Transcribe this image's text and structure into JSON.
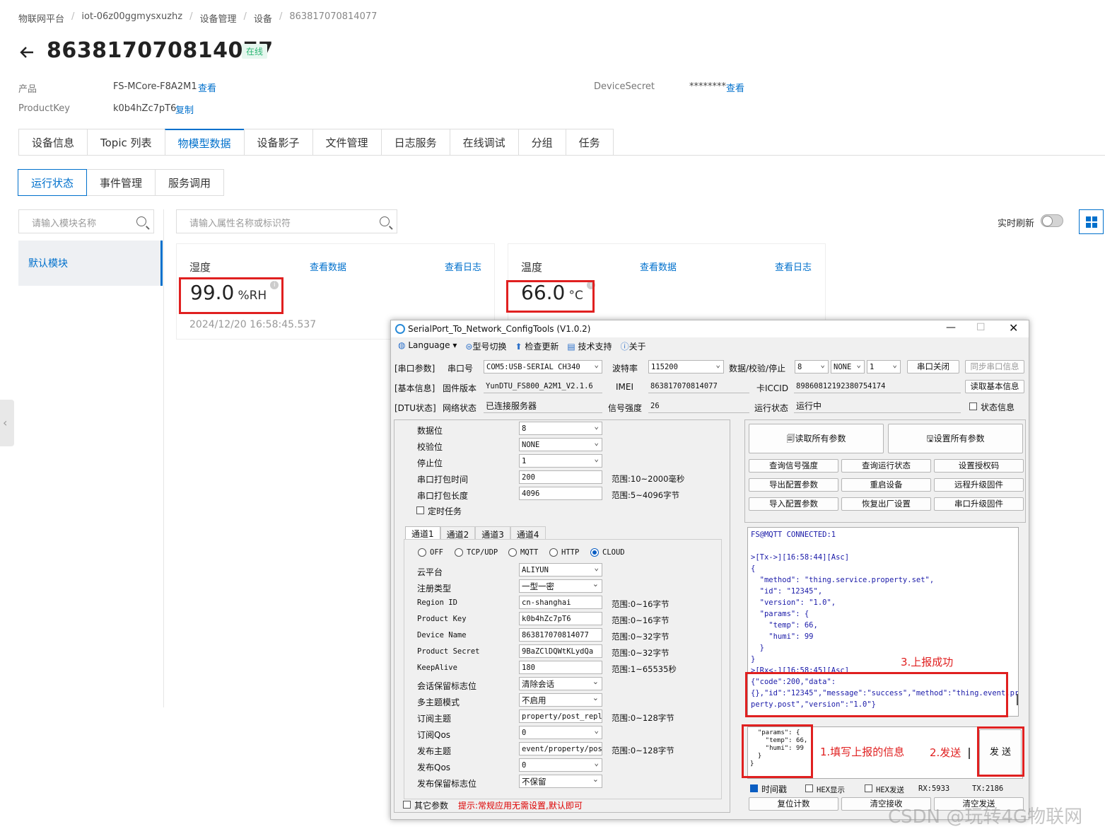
{
  "breadcrumb": [
    "物联网平台",
    "iot-06z00ggmysxuzhz",
    "设备管理",
    "设备",
    "863817070814077"
  ],
  "device": {
    "title": "863817070814077",
    "status": "在线"
  },
  "meta": {
    "product_label": "产品",
    "product_value": "FS-MCore-F8A2M1",
    "product_link": "查看",
    "pk_label": "ProductKey",
    "pk_value": "k0b4hZc7pT6",
    "pk_link": "复制",
    "secret_label": "DeviceSecret",
    "secret_value": "********",
    "secret_link": "查看"
  },
  "tabs": [
    "设备信息",
    "Topic 列表",
    "物模型数据",
    "设备影子",
    "文件管理",
    "日志服务",
    "在线调试",
    "分组",
    "任务"
  ],
  "subtabs": [
    "运行状态",
    "事件管理",
    "服务调用"
  ],
  "module_search_placeholder": "请输入模块名称",
  "prop_search_placeholder": "请输入属性名称或标识符",
  "realtime_label": "实时刷新",
  "module_item": "默认模块",
  "cards": [
    {
      "name": "湿度",
      "view_data": "查看数据",
      "view_log": "查看日志",
      "value": "99.0",
      "unit": "%RH",
      "time": "2024/12/20 16:58:45.537"
    },
    {
      "name": "温度",
      "view_data": "查看数据",
      "view_log": "查看日志",
      "value": "66.0",
      "unit": "°C"
    }
  ],
  "dialog": {
    "title": "SerialPort_To_Network_ConfigTools (V1.0.2)",
    "menu": [
      "Language",
      "型号切换",
      "检查更新",
      "技术支持",
      "关于"
    ],
    "row1": {
      "tag": "[串口参数]",
      "port_label": "串口号",
      "port": "COM5:USB-SERIAL CH340",
      "baud_label": "波特率",
      "baud": "115200",
      "dps_label": "数据/校验/停止",
      "d": "8",
      "p": "NONE",
      "s": "1",
      "close_btn": "串口关闭",
      "sync_btn": "同步串口信息"
    },
    "row2": {
      "tag": "[基本信息]",
      "fw_label": "固件版本",
      "fw": "YunDTU_FS800_A2M1_V2.1.6",
      "imei_label": "IMEI",
      "imei": "863817070814077",
      "iccid_label": "卡ICCID",
      "iccid": "89860812192380754174",
      "read_btn": "读取基本信息"
    },
    "row3": {
      "tag": "[DTU状态]",
      "net_label": "网络状态",
      "net": "已连接服务器",
      "sig_label": "信号强度",
      "sig": "26",
      "run_label": "运行状态",
      "run": "运行中",
      "state_chk": "状态信息"
    },
    "serial": {
      "rows": [
        {
          "label": "数据位",
          "value": "8",
          "range": ""
        },
        {
          "label": "校验位",
          "value": "NONE",
          "range": ""
        },
        {
          "label": "停止位",
          "value": "1",
          "range": ""
        },
        {
          "label": "串口打包时间",
          "value": "200",
          "range": "范围:10~2000毫秒"
        },
        {
          "label": "串口打包长度",
          "value": "4096",
          "range": "范围:5~4096字节"
        }
      ],
      "timer": "定时任务"
    },
    "channels": [
      "通道1",
      "通道2",
      "通道3",
      "通道4"
    ],
    "protocols": [
      "OFF",
      "TCP/UDP",
      "MQTT",
      "HTTP",
      "CLOUD"
    ],
    "cfg": [
      {
        "label": "云平台",
        "value": "ALIYUN",
        "range": ""
      },
      {
        "label": "注册类型",
        "value": "一型一密",
        "range": ""
      },
      {
        "label": "Region ID",
        "value": "cn-shanghai",
        "range": "范围:0~16字节"
      },
      {
        "label": "Product Key",
        "value": "k0b4hZc7pT6",
        "range": "范围:0~16字节"
      },
      {
        "label": "Device Name",
        "value": "863817070814077",
        "range": "范围:0~32字节"
      },
      {
        "label": "Product Secret",
        "value": "9BaZClDQWtKLydQa",
        "range": "范围:0~32字节"
      },
      {
        "label": "KeepAlive",
        "value": "180",
        "range": "范围:1~65535秒"
      },
      {
        "label": "会话保留标志位",
        "value": "清除会话",
        "range": ""
      },
      {
        "label": "多主题模式",
        "value": "不启用",
        "range": ""
      },
      {
        "label": "订阅主题",
        "value": "property/post_reply",
        "range": "范围:0~128字节"
      },
      {
        "label": "订阅Qos",
        "value": "0",
        "range": ""
      },
      {
        "label": "发布主题",
        "value": "event/property/post",
        "range": "范围:0~128字节"
      },
      {
        "label": "发布Qos",
        "value": "0",
        "range": ""
      },
      {
        "label": "发布保留标志位",
        "value": "不保留",
        "range": ""
      }
    ],
    "other_chk": "其它参数",
    "hint": "提示:常规应用无需设置,默认即可",
    "big_btns": [
      "读取所有参数",
      "设置所有参数"
    ],
    "grid_btns": [
      "查询信号强度",
      "查询运行状态",
      "设置授权码",
      "导出配置参数",
      "重启设备",
      "远程升级固件",
      "导入配置参数",
      "恢复出厂设置",
      "串口升级固件"
    ],
    "log": "FS@MQTT CONNECTED:1\n\n>[Tx->][16:58:44][Asc]\n{\n  \"method\": \"thing.service.property.set\",\n  \"id\": \"12345\",\n  \"version\": \"1.0\",\n  \"params\": {\n    \"temp\": 66,\n    \"humi\": 99\n  }\n}\n>[Rx<-][16:58:45][Asc]\n{\"code\":200,\"data\":\n{},\"id\":\"12345\",\"message\":\"success\",\"method\":\"thing.event.pro\nperty.post\",\"version\":\"1.0\"}",
    "send_text": "  \"params\": {\n    \"temp\": 66,\n    \"humi\": 99\n  }\n}",
    "send_btn": "发 送",
    "notes": [
      "3.上报成功",
      "1.填写上报的信息",
      "2.发送"
    ],
    "bottom": {
      "ts": "时间戳",
      "hexshow": "HEX显示",
      "hexsend": "HEX发送",
      "rx": "RX:5933",
      "tx": "TX:2186",
      "reset": "复位计数",
      "clr_rx": "清空接收",
      "clr_tx": "清空发送"
    }
  },
  "watermark": "CSDN @玩转4G物联网"
}
